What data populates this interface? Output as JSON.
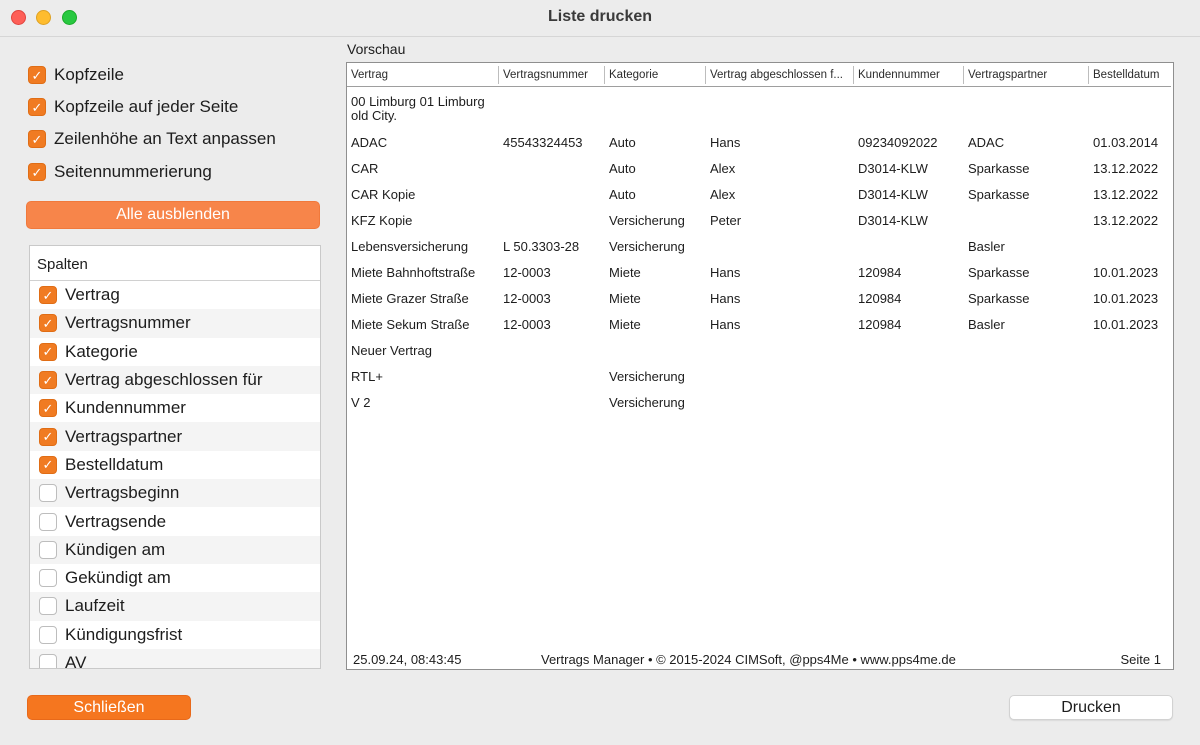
{
  "window": {
    "title": "Liste drucken"
  },
  "options": [
    {
      "label": "Kopfzeile",
      "checked": true
    },
    {
      "label": "Kopfzeile auf jeder Seite",
      "checked": true
    },
    {
      "label": "Zeilenhöhe an Text anpassen",
      "checked": true
    },
    {
      "label": "Seitennummerierung",
      "checked": true
    }
  ],
  "hide_all_label": "Alle ausblenden",
  "columns_panel": {
    "header": "Spalten",
    "items": [
      {
        "label": "Vertrag",
        "checked": true
      },
      {
        "label": "Vertragsnummer",
        "checked": true
      },
      {
        "label": "Kategorie",
        "checked": true
      },
      {
        "label": "Vertrag abgeschlossen für",
        "checked": true
      },
      {
        "label": "Kundennummer",
        "checked": true
      },
      {
        "label": "Vertragspartner",
        "checked": true
      },
      {
        "label": "Bestelldatum",
        "checked": true
      },
      {
        "label": "Vertragsbeginn",
        "checked": false
      },
      {
        "label": "Vertragsende",
        "checked": false
      },
      {
        "label": "Kündigen am",
        "checked": false
      },
      {
        "label": "Gekündigt am",
        "checked": false
      },
      {
        "label": "Laufzeit",
        "checked": false
      },
      {
        "label": "Kündigungsfrist",
        "checked": false
      },
      {
        "label": "AV",
        "checked": false
      }
    ]
  },
  "preview": {
    "label": "Vorschau",
    "headers": [
      "Vertrag",
      "Vertragsnummer",
      "Kategorie",
      "Vertrag abgeschlossen f...",
      "Kundennummer",
      "Vertragspartner",
      "Bestelldatum"
    ],
    "rows": [
      [
        "00 Limburg 01 Limburg old City.",
        "",
        "",
        "",
        "",
        "",
        ""
      ],
      [
        "ADAC",
        "45543324453",
        "Auto",
        "Hans",
        "09234092022",
        "ADAC",
        "01.03.2014"
      ],
      [
        "CAR",
        "",
        "Auto",
        "Alex",
        "D3014-KLW",
        "Sparkasse",
        "13.12.2022"
      ],
      [
        "CAR Kopie",
        "",
        "Auto",
        "Alex",
        "D3014-KLW",
        "Sparkasse",
        "13.12.2022"
      ],
      [
        "KFZ Kopie",
        "",
        "Versicherung",
        "Peter",
        "D3014-KLW",
        "",
        "13.12.2022"
      ],
      [
        "Lebensversicherung",
        "L 50.3303-28",
        "Versicherung",
        "",
        "",
        "Basler",
        ""
      ],
      [
        "Miete Bahnhoftstraße",
        "12-0003",
        "Miete",
        "Hans",
        "120984",
        "Sparkasse",
        "10.01.2023"
      ],
      [
        "Miete Grazer Straße",
        "12-0003",
        "Miete",
        "Hans",
        "120984",
        "Sparkasse",
        "10.01.2023"
      ],
      [
        "Miete Sekum Straße",
        "12-0003",
        "Miete",
        "Hans",
        "120984",
        "Basler",
        "10.01.2023"
      ],
      [
        "Neuer Vertrag",
        "",
        "",
        "",
        "",
        "",
        ""
      ],
      [
        "RTL+",
        "",
        "Versicherung",
        "",
        "",
        "",
        ""
      ],
      [
        "V 2",
        "",
        "Versicherung",
        "",
        "",
        "",
        ""
      ]
    ],
    "footer": {
      "timestamp": "25.09.24, 08:43:45",
      "credits": "Vertrags Manager • © 2015-2024 CIMSoft, @pps4Me • www.pps4me.de",
      "page": "Seite  1"
    }
  },
  "buttons": {
    "close": "Schließen",
    "print": "Drucken"
  },
  "colors": {
    "accent": "#f5761f",
    "accent_light": "#f7854a"
  }
}
